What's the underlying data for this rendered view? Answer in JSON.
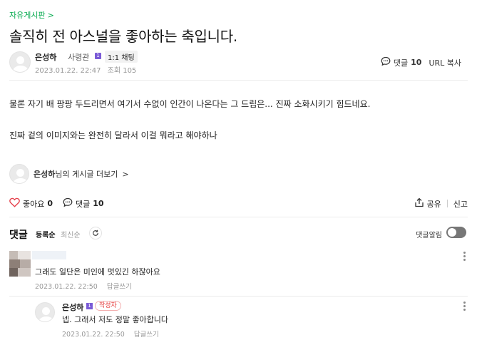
{
  "board": {
    "name": "자유게시판",
    "chevron": ">"
  },
  "post": {
    "title": "솔직히 전 아스널을 좋아하는 축입니다.",
    "author": {
      "name": "은성하",
      "rank": "사령관",
      "level_badge": "1",
      "chat_badge": "1:1 채팅"
    },
    "date": "2023.01.22. 22:47",
    "views": "조회 105",
    "comment_label": "댓글",
    "comment_count": "10",
    "url_copy": "URL 복사",
    "body": [
      "물론 자기 배 팡팡 두드리면서 여기서 수없이 인간이 나온다는 그 드립은... 진짜 소화시키기 힘드네요.",
      "진짜 겉의 이미지와는 완전히 달라서 이걸 뭐라고 해야하나"
    ],
    "more_posts": {
      "name": "은성하",
      "suffix": "님의 게시글 더보기",
      "chevron": ">"
    }
  },
  "action_bar": {
    "like_label": "좋아요",
    "like_count": "0",
    "comment_label": "댓글",
    "comment_count": "10",
    "share_label": "공유",
    "report_label": "신고"
  },
  "comments": {
    "heading": "댓글",
    "sort_registered": "등록순",
    "sort_latest": "최신순",
    "alarm_label": "댓글알림",
    "alarm_on": false,
    "items": [
      {
        "text": "그래도 일단은 미인에 멋있긴 하잖아요",
        "date": "2023.01.22. 22:50",
        "reply": "답글쓰기"
      },
      {
        "author": "은성하",
        "level_badge": "1",
        "writer_badge": "작성자",
        "text": "넵. 그래서 저도 정말 좋아합니다",
        "date": "2023.01.22. 22:50",
        "reply": "답글쓰기"
      }
    ]
  },
  "colors": {
    "accent": "#03a94d",
    "like": "#e5424d",
    "toggle": "#777777",
    "writer_badge": "#e53b3b"
  }
}
